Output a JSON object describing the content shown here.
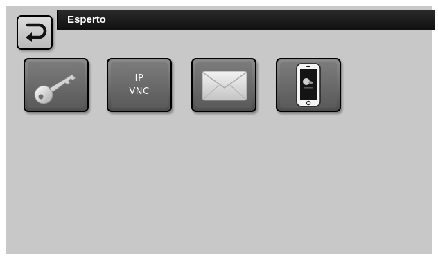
{
  "header": {
    "title": "Esperto"
  },
  "tiles": [
    {
      "name": "key",
      "icon": "key-icon"
    },
    {
      "name": "network",
      "line1": "IP",
      "line2": "VNC"
    },
    {
      "name": "email",
      "icon": "envelope-icon"
    },
    {
      "name": "mobile",
      "icon": "smartphone-icon"
    }
  ],
  "colors": {
    "background": "#c8c8c8",
    "titlebar": "#111111",
    "tile": "#6b6b6b"
  }
}
